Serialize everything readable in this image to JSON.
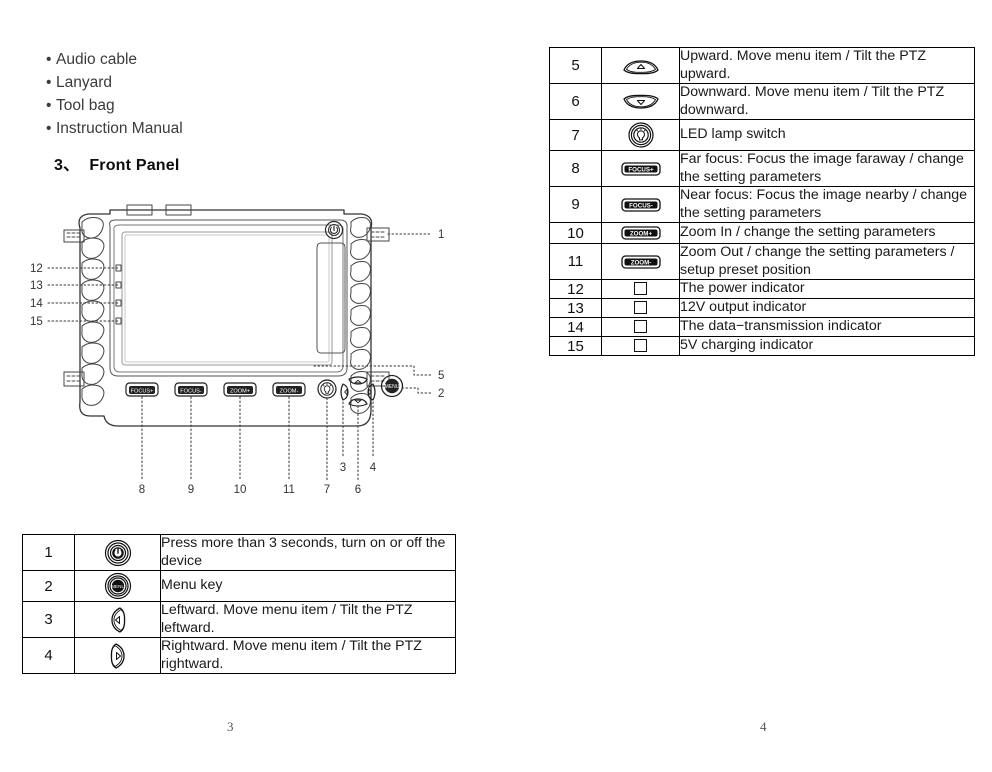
{
  "accessories": {
    "items": [
      "Audio cable",
      "Lanyard",
      "Tool bag",
      "Instruction Manual"
    ]
  },
  "heading": {
    "number": "3、",
    "title": "Front Panel"
  },
  "diagram": {
    "name": "front-panel-diagram",
    "button_labels": [
      "FOCUS+",
      "FOCUS-",
      "ZOOM+",
      "ZOOM-",
      "MENU"
    ],
    "callouts_right": [
      "1",
      "5",
      "2"
    ],
    "callouts_left": [
      "12",
      "13",
      "14",
      "15"
    ],
    "callouts_bottom": [
      "8",
      "9",
      "10",
      "11",
      "7",
      "6"
    ],
    "callouts_bottom_upper": [
      "3",
      "4"
    ]
  },
  "table_left": {
    "rows": [
      {
        "num": "1",
        "icon": "power-button-icon",
        "desc": "Press more than 3 seconds, turn on or off the device"
      },
      {
        "num": "2",
        "icon": "menu-button-icon",
        "desc": "Menu key"
      },
      {
        "num": "3",
        "icon": "left-arrow-key-icon",
        "desc": "Leftward. Move menu item / Tilt the PTZ leftward."
      },
      {
        "num": "4",
        "icon": "right-arrow-key-icon",
        "desc": "Rightward. Move menu item / Tilt the PTZ rightward."
      }
    ]
  },
  "table_right": {
    "rows": [
      {
        "num": "5",
        "icon": "up-arrow-key-icon",
        "desc": "Upward. Move menu item / Tilt the PTZ upward."
      },
      {
        "num": "6",
        "icon": "down-arrow-key-icon",
        "desc": "Downward. Move menu item / Tilt the PTZ downward."
      },
      {
        "num": "7",
        "icon": "led-lamp-button-icon",
        "desc": "LED lamp switch"
      },
      {
        "num": "8",
        "icon": "focus-plus-button-icon",
        "desc": "Far focus: Focus the image faraway / change the setting parameters"
      },
      {
        "num": "9",
        "icon": "focus-minus-button-icon",
        "desc": "Near focus: Focus the image nearby / change the setting parameters"
      },
      {
        "num": "10",
        "icon": "zoom-plus-button-icon",
        "desc": "Zoom In / change the setting parameters"
      },
      {
        "num": "11",
        "icon": "zoom-minus-button-icon",
        "desc": "Zoom Out / change the setting parameters / setup preset position"
      },
      {
        "num": "12",
        "icon": "indicator-square-icon",
        "desc": "The power indicator"
      },
      {
        "num": "13",
        "icon": "indicator-square-icon",
        "desc": "12V output indicator"
      },
      {
        "num": "14",
        "icon": "indicator-square-icon",
        "desc": "The data−transmission indicator"
      },
      {
        "num": "15",
        "icon": "indicator-square-icon",
        "desc": "5V charging indicator"
      }
    ]
  },
  "icon_labels": {
    "focus_plus": "FOCUS+",
    "focus_minus": "FOCUS-",
    "zoom_plus": "ZOOM+",
    "zoom_minus": "ZOOM-",
    "menu": "MENU"
  },
  "footer": {
    "page_left": "3",
    "page_right": "4"
  },
  "colors": {
    "ink": "#111111",
    "text": "#1a1a1a",
    "muted": "#555555",
    "line": "#000000"
  }
}
